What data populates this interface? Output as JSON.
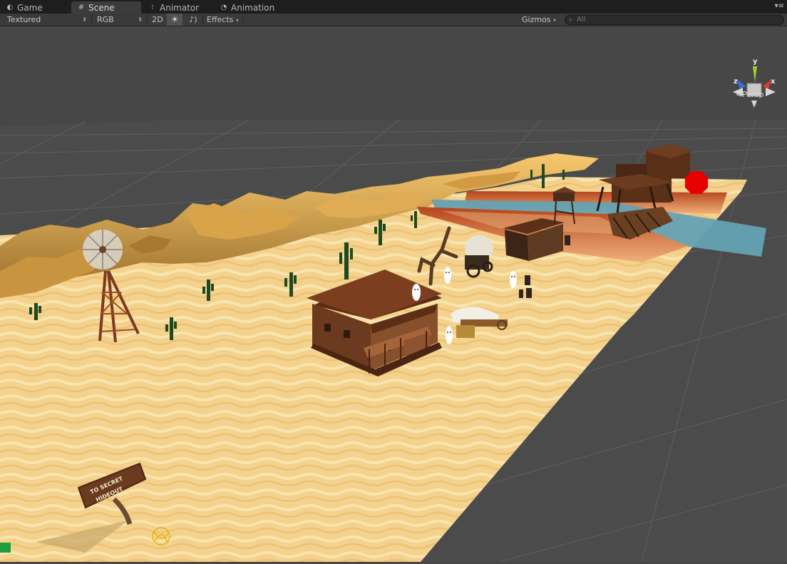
{
  "tabs": [
    {
      "label": "Game",
      "icon": "game-icon"
    },
    {
      "label": "Scene",
      "icon": "scene-icon"
    },
    {
      "label": "Animator",
      "icon": "animator-icon"
    },
    {
      "label": "Animation",
      "icon": "animation-icon"
    }
  ],
  "toolbar": {
    "shading_mode": "Textured",
    "render_mode": "RGB",
    "mode_2d": "2D",
    "effects_label": "Effects",
    "gizmos_label": "Gizmos",
    "search_placeholder": "All"
  },
  "gizmo": {
    "y": "y",
    "z": "z",
    "x": "x",
    "projection": "Persp"
  },
  "scene": {
    "sign_line1": "TO SECRET",
    "sign_line2": "HIDEOUT"
  },
  "colors": {
    "sand": "#f2cf86",
    "grid": "#474747",
    "wood": "#6e3f22",
    "water": "#5f9eb0",
    "stop": "#e80000"
  }
}
